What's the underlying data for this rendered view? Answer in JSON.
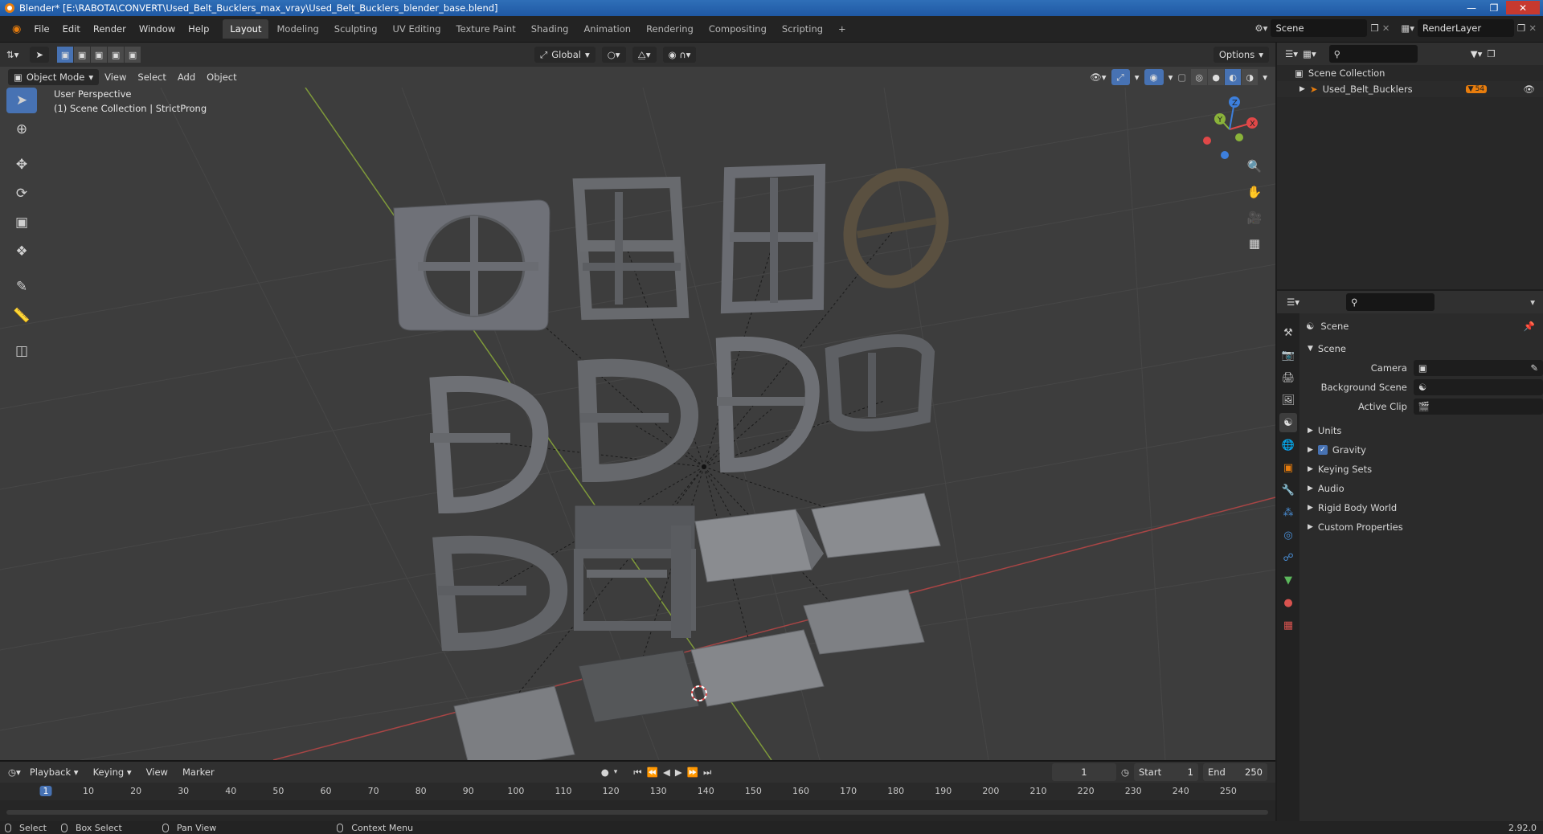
{
  "window": {
    "title": "Blender* [E:\\RABOTA\\CONVERT\\Used_Belt_Bucklers_max_vray\\Used_Belt_Bucklers_blender_base.blend]"
  },
  "menu": [
    "File",
    "Edit",
    "Render",
    "Window",
    "Help"
  ],
  "workspaces": [
    {
      "label": "Layout",
      "active": true
    },
    {
      "label": "Modeling"
    },
    {
      "label": "Sculpting"
    },
    {
      "label": "UV Editing"
    },
    {
      "label": "Texture Paint"
    },
    {
      "label": "Shading"
    },
    {
      "label": "Animation"
    },
    {
      "label": "Rendering"
    },
    {
      "label": "Compositing"
    },
    {
      "label": "Scripting"
    }
  ],
  "top_right": {
    "scene": "Scene",
    "view_layer": "RenderLayer"
  },
  "viewport": {
    "orientation": "Global",
    "options_label": "Options",
    "mode": "Object Mode",
    "header_menu": [
      "View",
      "Select",
      "Add",
      "Object"
    ],
    "info_line1": "User Perspective",
    "info_line2": "(1) Scene Collection | StrictProng",
    "gizmo": {
      "x": "X",
      "y": "Y",
      "z": "Z"
    }
  },
  "outliner": {
    "root": "Scene Collection",
    "items": [
      {
        "label": "Used_Belt_Bucklers",
        "badge": "54"
      }
    ]
  },
  "properties": {
    "context": "Scene",
    "panel": "Scene",
    "fields": [
      {
        "label": "Camera",
        "value": ""
      },
      {
        "label": "Background Scene",
        "value": ""
      },
      {
        "label": "Active Clip",
        "value": ""
      }
    ],
    "sections": [
      {
        "label": "Units"
      },
      {
        "label": "Gravity",
        "checked": true
      },
      {
        "label": "Keying Sets"
      },
      {
        "label": "Audio"
      },
      {
        "label": "Rigid Body World"
      },
      {
        "label": "Custom Properties"
      }
    ]
  },
  "timeline": {
    "menu": [
      "Playback",
      "Keying",
      "View",
      "Marker"
    ],
    "current_frame": "1",
    "start_label": "Start",
    "start": "1",
    "end_label": "End",
    "end": "250",
    "ruler": [
      "1",
      "10",
      "20",
      "30",
      "40",
      "50",
      "60",
      "70",
      "80",
      "90",
      "100",
      "110",
      "120",
      "130",
      "140",
      "150",
      "160",
      "170",
      "180",
      "190",
      "200",
      "210",
      "220",
      "230",
      "240",
      "250"
    ]
  },
  "status": {
    "select": "Select",
    "box_select": "Box Select",
    "pan_view": "Pan View",
    "context_menu": "Context Menu",
    "version": "2.92.0"
  },
  "colors": {
    "accent": "#4772b3",
    "viewport_bg": "#3d3d3d",
    "x_axis": "#e04848",
    "y_axis": "#8ab33a",
    "z_axis": "#3d7fdc",
    "orange": "#e87d0d"
  }
}
